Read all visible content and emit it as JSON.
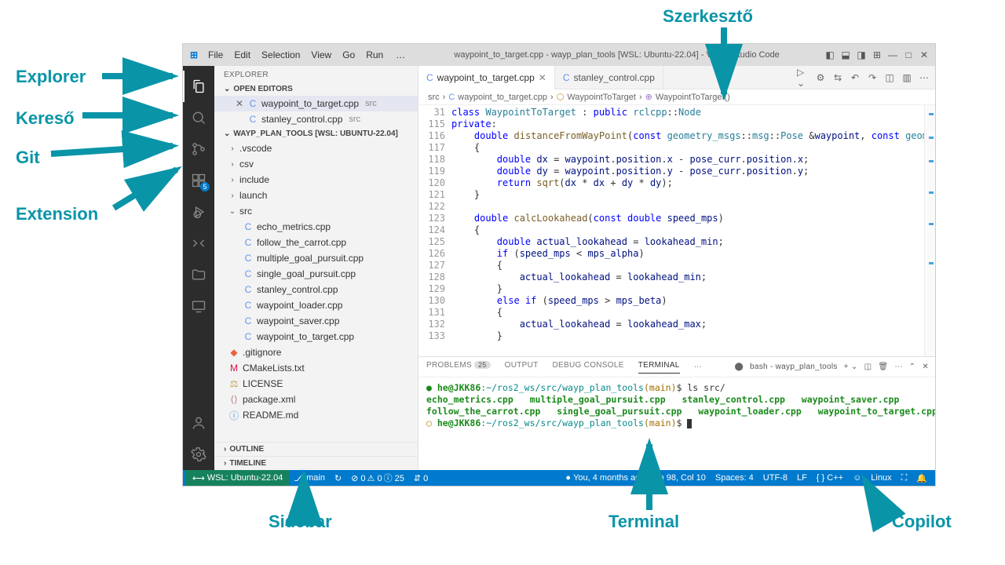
{
  "annotations": {
    "editor": "Szerkesztő",
    "explorer": "Explorer",
    "search": "Kereső",
    "git": "Git",
    "extension": "Extension",
    "sidebar": "Sidebar",
    "terminal": "Terminal",
    "copilot": "Copilot"
  },
  "titlebar": {
    "menu": [
      "File",
      "Edit",
      "Selection",
      "View",
      "Go",
      "Run"
    ],
    "dots": "…",
    "title": "waypoint_to_target.cpp - wayp_plan_tools [WSL: Ubuntu-22.04] - Visual Studio Code"
  },
  "activitybar": {
    "ext_badge": "5"
  },
  "sidebar": {
    "title": "EXPLORER",
    "open_editors_label": "OPEN EDITORS",
    "open_editors": [
      {
        "name": "waypoint_to_target.cpp",
        "hint": "src",
        "active": true
      },
      {
        "name": "stanley_control.cpp",
        "hint": "src",
        "active": false
      }
    ],
    "ws_label": "WAYP_PLAN_TOOLS [WSL: UBUNTU-22.04]",
    "folders": [
      ".vscode",
      "csv",
      "include",
      "launch"
    ],
    "src_label": "src",
    "src_files": [
      "echo_metrics.cpp",
      "follow_the_carrot.cpp",
      "multiple_goal_pursuit.cpp",
      "single_goal_pursuit.cpp",
      "stanley_control.cpp",
      "waypoint_loader.cpp",
      "waypoint_saver.cpp",
      "waypoint_to_target.cpp"
    ],
    "root_files": [
      {
        "name": ".gitignore",
        "cls": "fi-git",
        "glyph": "◆"
      },
      {
        "name": "CMakeLists.txt",
        "cls": "fi-cmake",
        "glyph": "M"
      },
      {
        "name": "LICENSE",
        "cls": "fi-lic",
        "glyph": "⚖"
      },
      {
        "name": "package.xml",
        "cls": "fi-xml",
        "glyph": "⟨⟩"
      },
      {
        "name": "README.md",
        "cls": "fi-md",
        "glyph": "ⓘ"
      }
    ],
    "outline": "OUTLINE",
    "timeline": "TIMELINE"
  },
  "tabs": [
    {
      "name": "waypoint_to_target.cpp",
      "active": true,
      "closable": true
    },
    {
      "name": "stanley_control.cpp",
      "active": false,
      "closable": false
    }
  ],
  "breadcrumb": {
    "p1": "src",
    "p2": "waypoint_to_target.cpp",
    "p3": "WaypointToTarget",
    "p4": "WaypointToTarget()"
  },
  "code": {
    "start": 31,
    "lines": [
      {
        "n": 31,
        "html": "<span class='kw'>class</span> <span class='typ'>WaypointToTarget</span> : <span class='kw'>public</span> <span class='typ'>rclcpp</span>::<span class='typ'>Node</span>"
      },
      {
        "n": 115,
        "html": "<span class='kw'>private</span>:"
      },
      {
        "n": 116,
        "html": "    <span class='kw'>double</span> <span class='fn'>distanceFromWayPoint</span>(<span class='kw'>const</span> <span class='typ'>geometry_msgs</span>::<span class='typ'>msg</span>::<span class='typ'>Pose</span> &amp;<span class='var'>waypoint</span>, <span class='kw'>const</span> <span class='typ'>geometry_m</span>"
      },
      {
        "n": 117,
        "html": "    {"
      },
      {
        "n": 118,
        "html": "        <span class='kw'>double</span> <span class='var'>dx</span> = <span class='var'>waypoint</span>.<span class='var'>position</span>.<span class='var'>x</span> - <span class='var'>pose_curr</span>.<span class='var'>position</span>.<span class='var'>x</span>;"
      },
      {
        "n": 119,
        "html": "        <span class='kw'>double</span> <span class='var'>dy</span> = <span class='var'>waypoint</span>.<span class='var'>position</span>.<span class='var'>y</span> - <span class='var'>pose_curr</span>.<span class='var'>position</span>.<span class='var'>y</span>;"
      },
      {
        "n": 120,
        "html": "        <span class='kw'>return</span> <span class='fn'>sqrt</span>(<span class='var'>dx</span> * <span class='var'>dx</span> + <span class='var'>dy</span> * <span class='var'>dy</span>);"
      },
      {
        "n": 121,
        "html": "    }"
      },
      {
        "n": 122,
        "html": ""
      },
      {
        "n": 123,
        "html": "    <span class='kw'>double</span> <span class='fn'>calcLookahead</span>(<span class='kw'>const</span> <span class='kw'>double</span> <span class='var'>speed_mps</span>)"
      },
      {
        "n": 124,
        "html": "    {"
      },
      {
        "n": 125,
        "html": "        <span class='kw'>double</span> <span class='var'>actual_lookahead</span> = <span class='var'>lookahead_min</span>;"
      },
      {
        "n": 126,
        "html": "        <span class='kw'>if</span> (<span class='var'>speed_mps</span> &lt; <span class='var'>mps_alpha</span>)"
      },
      {
        "n": 127,
        "html": "        {"
      },
      {
        "n": 128,
        "html": "            <span class='var'>actual_lookahead</span> = <span class='var'>lookahead_min</span>;"
      },
      {
        "n": 129,
        "html": "        }"
      },
      {
        "n": 130,
        "html": "        <span class='kw'>else</span> <span class='kw'>if</span> (<span class='var'>speed_mps</span> &gt; <span class='var'>mps_beta</span>)"
      },
      {
        "n": 131,
        "html": "        {"
      },
      {
        "n": 132,
        "html": "            <span class='var'>actual_lookahead</span> = <span class='var'>lookahead_max</span>;"
      },
      {
        "n": 133,
        "html": "        }"
      }
    ]
  },
  "panel": {
    "tabs": {
      "problems": "PROBLEMS",
      "problems_badge": "25",
      "output": "OUTPUT",
      "debug": "DEBUG CONSOLE",
      "terminal": "TERMINAL",
      "more": "…"
    },
    "term_label": "bash - wayp_plan_tools",
    "terminal": {
      "prompt1_user": "he@JKK86",
      "prompt1_path": ":~/ros2_ws/src/wayp_plan_tools",
      "prompt1_branch": "(main)",
      "cmd1": "ls src/",
      "files_row1": [
        "echo_metrics.cpp",
        "multiple_goal_pursuit.cpp",
        "stanley_control.cpp",
        "waypoint_saver.cpp"
      ],
      "files_row2": [
        "follow_the_carrot.cpp",
        "single_goal_pursuit.cpp",
        "waypoint_loader.cpp",
        "waypoint_to_target.cpp"
      ],
      "prompt2_user": "he@JKK86",
      "prompt2_path": ":~/ros2_ws/src/wayp_plan_tools",
      "prompt2_branch": "(main)"
    }
  },
  "statusbar": {
    "remote": "WSL: Ubuntu-22.04",
    "branch": "main",
    "sync": "↻",
    "err": "⊘ 0",
    "warn": "⚠ 0",
    "info": "ⓘ 25",
    "ports": "⇵ 0",
    "you": "You, 4 months ago",
    "pos": "Ln 98, Col 10",
    "spaces": "Spaces: 4",
    "enc": "UTF-8",
    "eol": "LF",
    "lang": "{ } C++",
    "os": "Linux"
  }
}
